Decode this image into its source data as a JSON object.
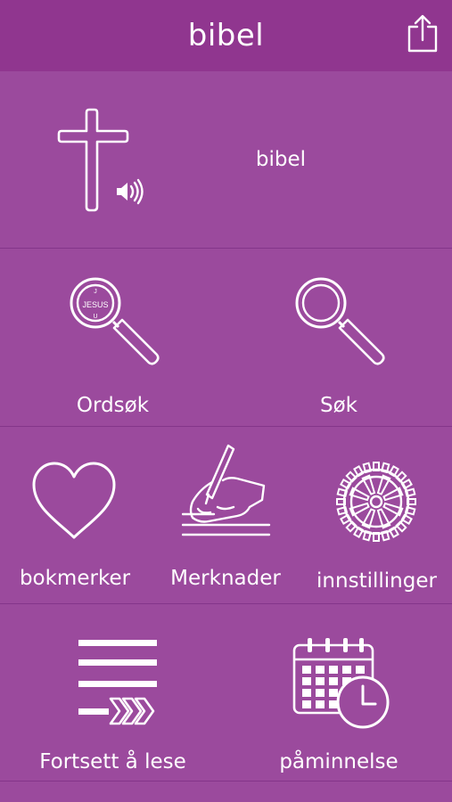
{
  "navbar": {
    "title": "bibel",
    "share_icon": "share-icon"
  },
  "audio_bible": {
    "label": "bibel",
    "icon": "cross-speaker-icon"
  },
  "search_row": {
    "word_search": {
      "label": "Ordsøk",
      "icon": "jesus-magnifier-icon",
      "icon_text": "JESUS"
    },
    "search": {
      "label": "Søk",
      "icon": "magnifier-icon"
    }
  },
  "tools_row": {
    "bookmarks": {
      "label": "bokmerker",
      "icon": "heart-icon"
    },
    "notes": {
      "label": "Merknader",
      "icon": "writing-hand-icon"
    },
    "settings": {
      "label": "innstillinger",
      "icon": "gear-icon"
    }
  },
  "reading_row": {
    "continue": {
      "label": "Fortsett å lese",
      "icon": "list-forward-icon"
    },
    "reminder": {
      "label": "påminnelse",
      "icon": "calendar-clock-icon"
    }
  },
  "colors": {
    "background": "#9b4a9d",
    "navbar": "#90368f",
    "divider": "#84358a",
    "foreground": "#ffffff"
  }
}
